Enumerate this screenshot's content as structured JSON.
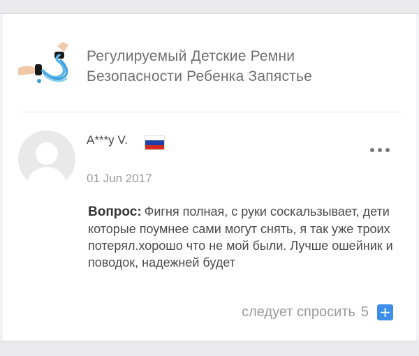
{
  "product": {
    "thumb_icon": "child-wrist-harness-image",
    "title": "Регулируемый Детские Ремни Безопасности Ребенка Запястье"
  },
  "review": {
    "author": "A***y V.",
    "country_flag": "russia-flag-icon",
    "date": "01 Jun 2017",
    "question_label": "Вопрос:",
    "text": "Фигня полная, с руки соскальзывает, дети которые поумнее сами могут снять, я так уже троих потерял.хорошо что не мой были. Лучше ошейник и поводок, надежней будет",
    "more_icon": "more-dots-icon"
  },
  "ask": {
    "label": "следует спросить",
    "count": "5",
    "plus_icon": "plus-icon",
    "accent_color": "#3d8ee8"
  },
  "colors": {
    "flag_white": "#ffffff",
    "flag_blue": "#1c3fa8",
    "flag_red": "#d52b1e"
  }
}
